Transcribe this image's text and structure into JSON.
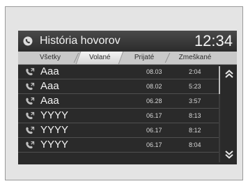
{
  "header": {
    "title": "História hovorov",
    "clock": "12:34",
    "icon": "phone-handset-icon"
  },
  "tabs": [
    {
      "label": "Všetky",
      "active": false
    },
    {
      "label": "Volané",
      "active": true
    },
    {
      "label": "Prijaté",
      "active": false
    },
    {
      "label": "Zmeškané",
      "active": false
    }
  ],
  "calls": [
    {
      "name": "Aaa",
      "date": "08.03",
      "time": "2:04",
      "icon": "outgoing-call-icon"
    },
    {
      "name": "Aaa",
      "date": "08.02",
      "time": "5:23",
      "icon": "outgoing-call-icon"
    },
    {
      "name": "Aaa",
      "date": "06.28",
      "time": "3:57",
      "icon": "outgoing-call-icon"
    },
    {
      "name": "YYYY",
      "date": "06.17",
      "time": "8:13",
      "icon": "outgoing-call-icon"
    },
    {
      "name": "YYYY",
      "date": "06.17",
      "time": "8:12",
      "icon": "outgoing-call-icon"
    },
    {
      "name": "YYYY",
      "date": "06.17",
      "time": "8:04",
      "icon": "outgoing-call-icon"
    }
  ],
  "scroll": {
    "up_icon": "double-chevron-up-icon",
    "down_icon": "double-chevron-down-icon"
  },
  "colors": {
    "screen_bg": "#2a2a2a",
    "tab_bar": "#c9c9c9",
    "text": "#f4f4f4"
  }
}
